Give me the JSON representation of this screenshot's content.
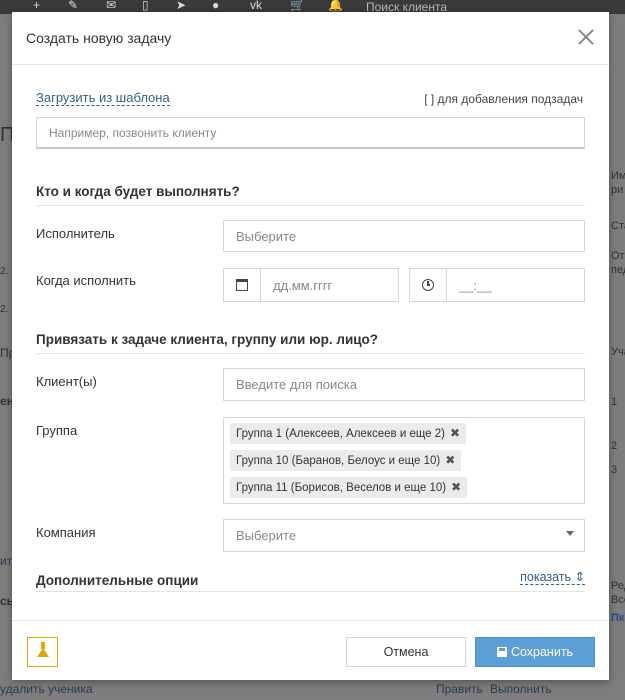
{
  "background": {
    "topbar_icons": [
      "+",
      "✎",
      "✉",
      "▯",
      "➤",
      "●",
      "vk",
      "🛒",
      "🔔"
    ],
    "search_label": "Поиск клиента",
    "left_fragments": [
      "П",
      "2.",
      "2.",
      "Пр",
      "ен",
      "ит",
      "сы"
    ],
    "right_fragments": [
      "Им",
      "ри",
      "Ста",
      "Отв",
      "пед",
      "Уча",
      "1",
      "2",
      "3",
      "Ред",
      "Все",
      "Пк"
    ],
    "bottom_left": "удалить ученика",
    "bottom_right": [
      "Править",
      "Выполнить"
    ]
  },
  "modal": {
    "title": "Создать новую задачу",
    "template_link": "Загрузить из шаблона",
    "subtask_hint": "[ ] для добавления подзадач",
    "task_placeholder": "Например, позвонить клиенту",
    "section_who": "Кто и когда будет выполнять?",
    "assignee_label": "Исполнитель",
    "assignee_placeholder": "Выберите",
    "when_label": "Когда исполнить",
    "date_placeholder": "дд.мм.гггг",
    "time_placeholder": "__:__",
    "section_link": "Привязать к задаче клиента, группу или юр. лицо?",
    "client_label": "Клиент(ы)",
    "client_placeholder": "Введите для поиска",
    "group_label": "Группа",
    "groups": [
      "Группа 1 (Алексеев, Алексеев и еще 2)",
      "Группа 10 (Баранов, Белоус и еще 10)",
      "Группа 11 (Борисов, Веселов и еще 10)"
    ],
    "company_label": "Компания",
    "company_placeholder": "Выберите",
    "extra_title": "Дополнительные опции",
    "show_link": "показать ⇕",
    "cancel_label": "Отмена",
    "save_label": "Сохранить"
  },
  "colors": {
    "accent": "#5b9fd6",
    "link": "#2f5f8a",
    "warning": "#e5a400"
  }
}
